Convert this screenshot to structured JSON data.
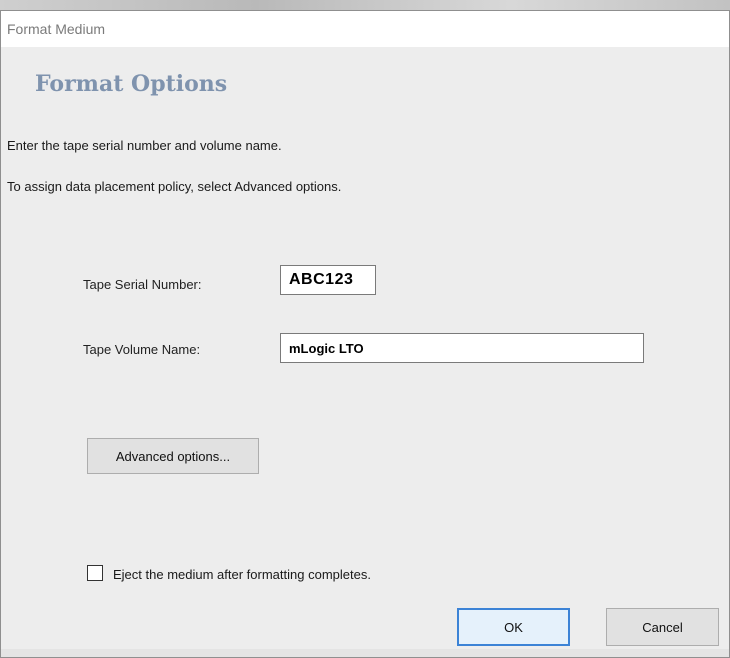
{
  "window": {
    "title": "Format Medium"
  },
  "main": {
    "heading": "Format Options",
    "instructions": [
      "Enter the tape serial number and volume name.",
      "To assign data placement policy, select Advanced options."
    ],
    "fields": {
      "serial": {
        "label": "Tape Serial Number:",
        "value": "ABC123"
      },
      "volume": {
        "label": "Tape Volume Name:",
        "value": "mLogic LTO"
      }
    },
    "advanced_button": "Advanced options...",
    "eject_checkbox": {
      "label": "Eject the medium after formatting completes.",
      "checked": false
    }
  },
  "footer": {
    "ok": "OK",
    "cancel": "Cancel"
  },
  "colors": {
    "heading": "#7f93ae",
    "ok_border": "#3c83d6",
    "dialog_bg": "#ededed"
  }
}
